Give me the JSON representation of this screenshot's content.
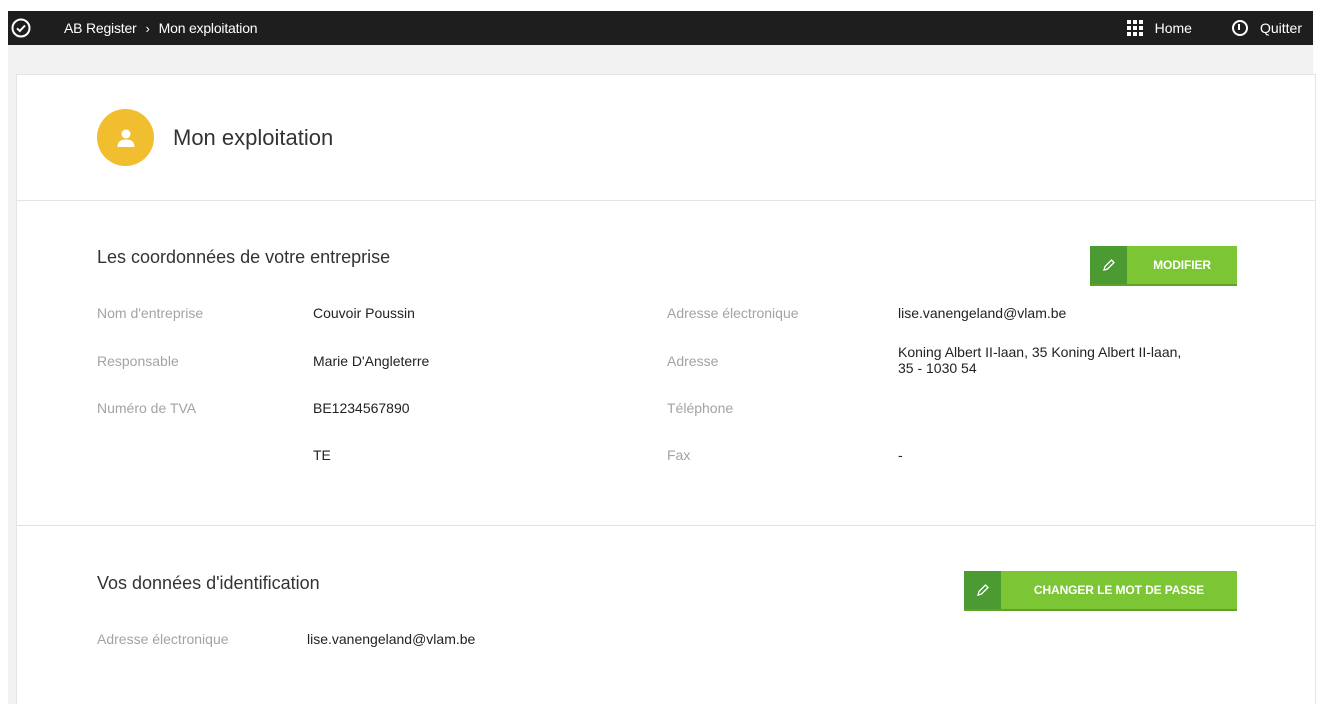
{
  "topbar": {
    "breadcrumb": [
      "AB Register",
      "Mon exploitation"
    ],
    "separator": "›",
    "home_label": "Home",
    "quit_label": "Quitter"
  },
  "page": {
    "title": "Mon exploitation"
  },
  "company": {
    "title": "Les coordonnées de votre entreprise",
    "edit_button": "MODIFIER",
    "left_fields": [
      {
        "label": "Nom d'entreprise",
        "value": "Couvoir Poussin"
      },
      {
        "label": "Responsable",
        "value": "Marie D'Angleterre"
      },
      {
        "label": "Numéro de TVA",
        "value": "BE1234567890"
      },
      {
        "label": "",
        "value": "TE"
      }
    ],
    "right_fields": [
      {
        "label": "Adresse électronique",
        "value": "lise.vanengeland@vlam.be"
      },
      {
        "label": "Adresse",
        "value_line1": "Koning Albert II-laan, 35 Koning Albert II-laan,",
        "value_line2": "35 - 1030 54"
      },
      {
        "label": "Téléphone",
        "value": ""
      },
      {
        "label": "Fax",
        "value": "-"
      }
    ]
  },
  "identification": {
    "title": "Vos données d'identification",
    "password_button": "CHANGER LE MOT DE PASSE",
    "email_label": "Adresse électronique",
    "email_value": "lise.vanengeland@vlam.be"
  },
  "colors": {
    "topbar": "#1e1e1e",
    "avatar": "#f0be2e",
    "button": "#7cc535",
    "button_icon": "#4c9a32"
  }
}
